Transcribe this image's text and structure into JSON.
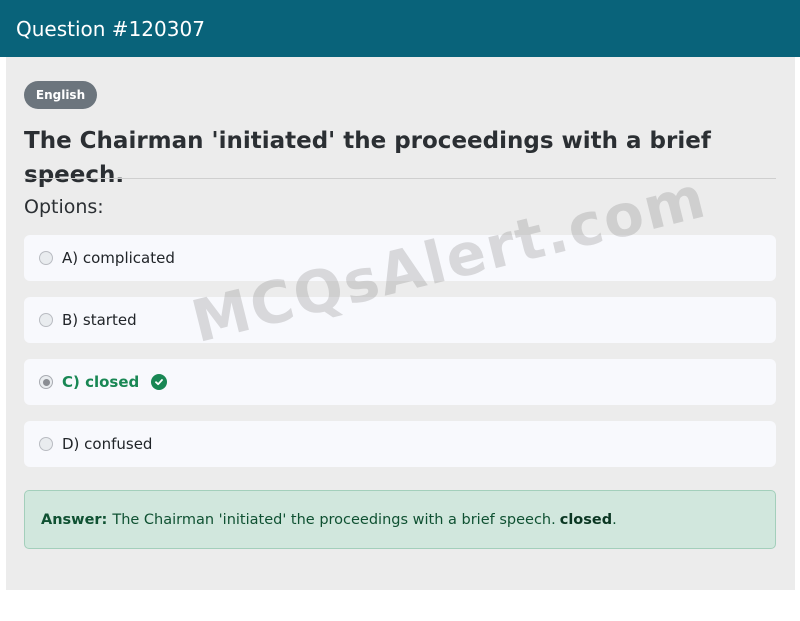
{
  "header": {
    "title": "Question #120307"
  },
  "badge": {
    "label": "English"
  },
  "question": {
    "text": "The Chairman 'initiated' the proceedings with a brief speech."
  },
  "options_heading": "Options:",
  "options": [
    {
      "label": "A) complicated",
      "selected": false,
      "correct": false
    },
    {
      "label": "B) started",
      "selected": false,
      "correct": false
    },
    {
      "label": "C) closed",
      "selected": true,
      "correct": true
    },
    {
      "label": "D) confused",
      "selected": false,
      "correct": false
    }
  ],
  "answer": {
    "label": "Answer:",
    "text": "The Chairman 'initiated' the proceedings with a brief speech.",
    "correct": "closed",
    "suffix": "."
  },
  "watermark": "MCQsAlert.com",
  "colors": {
    "header": "#09637a",
    "correct": "#198754",
    "answer_bg": "#d1e7dd"
  }
}
